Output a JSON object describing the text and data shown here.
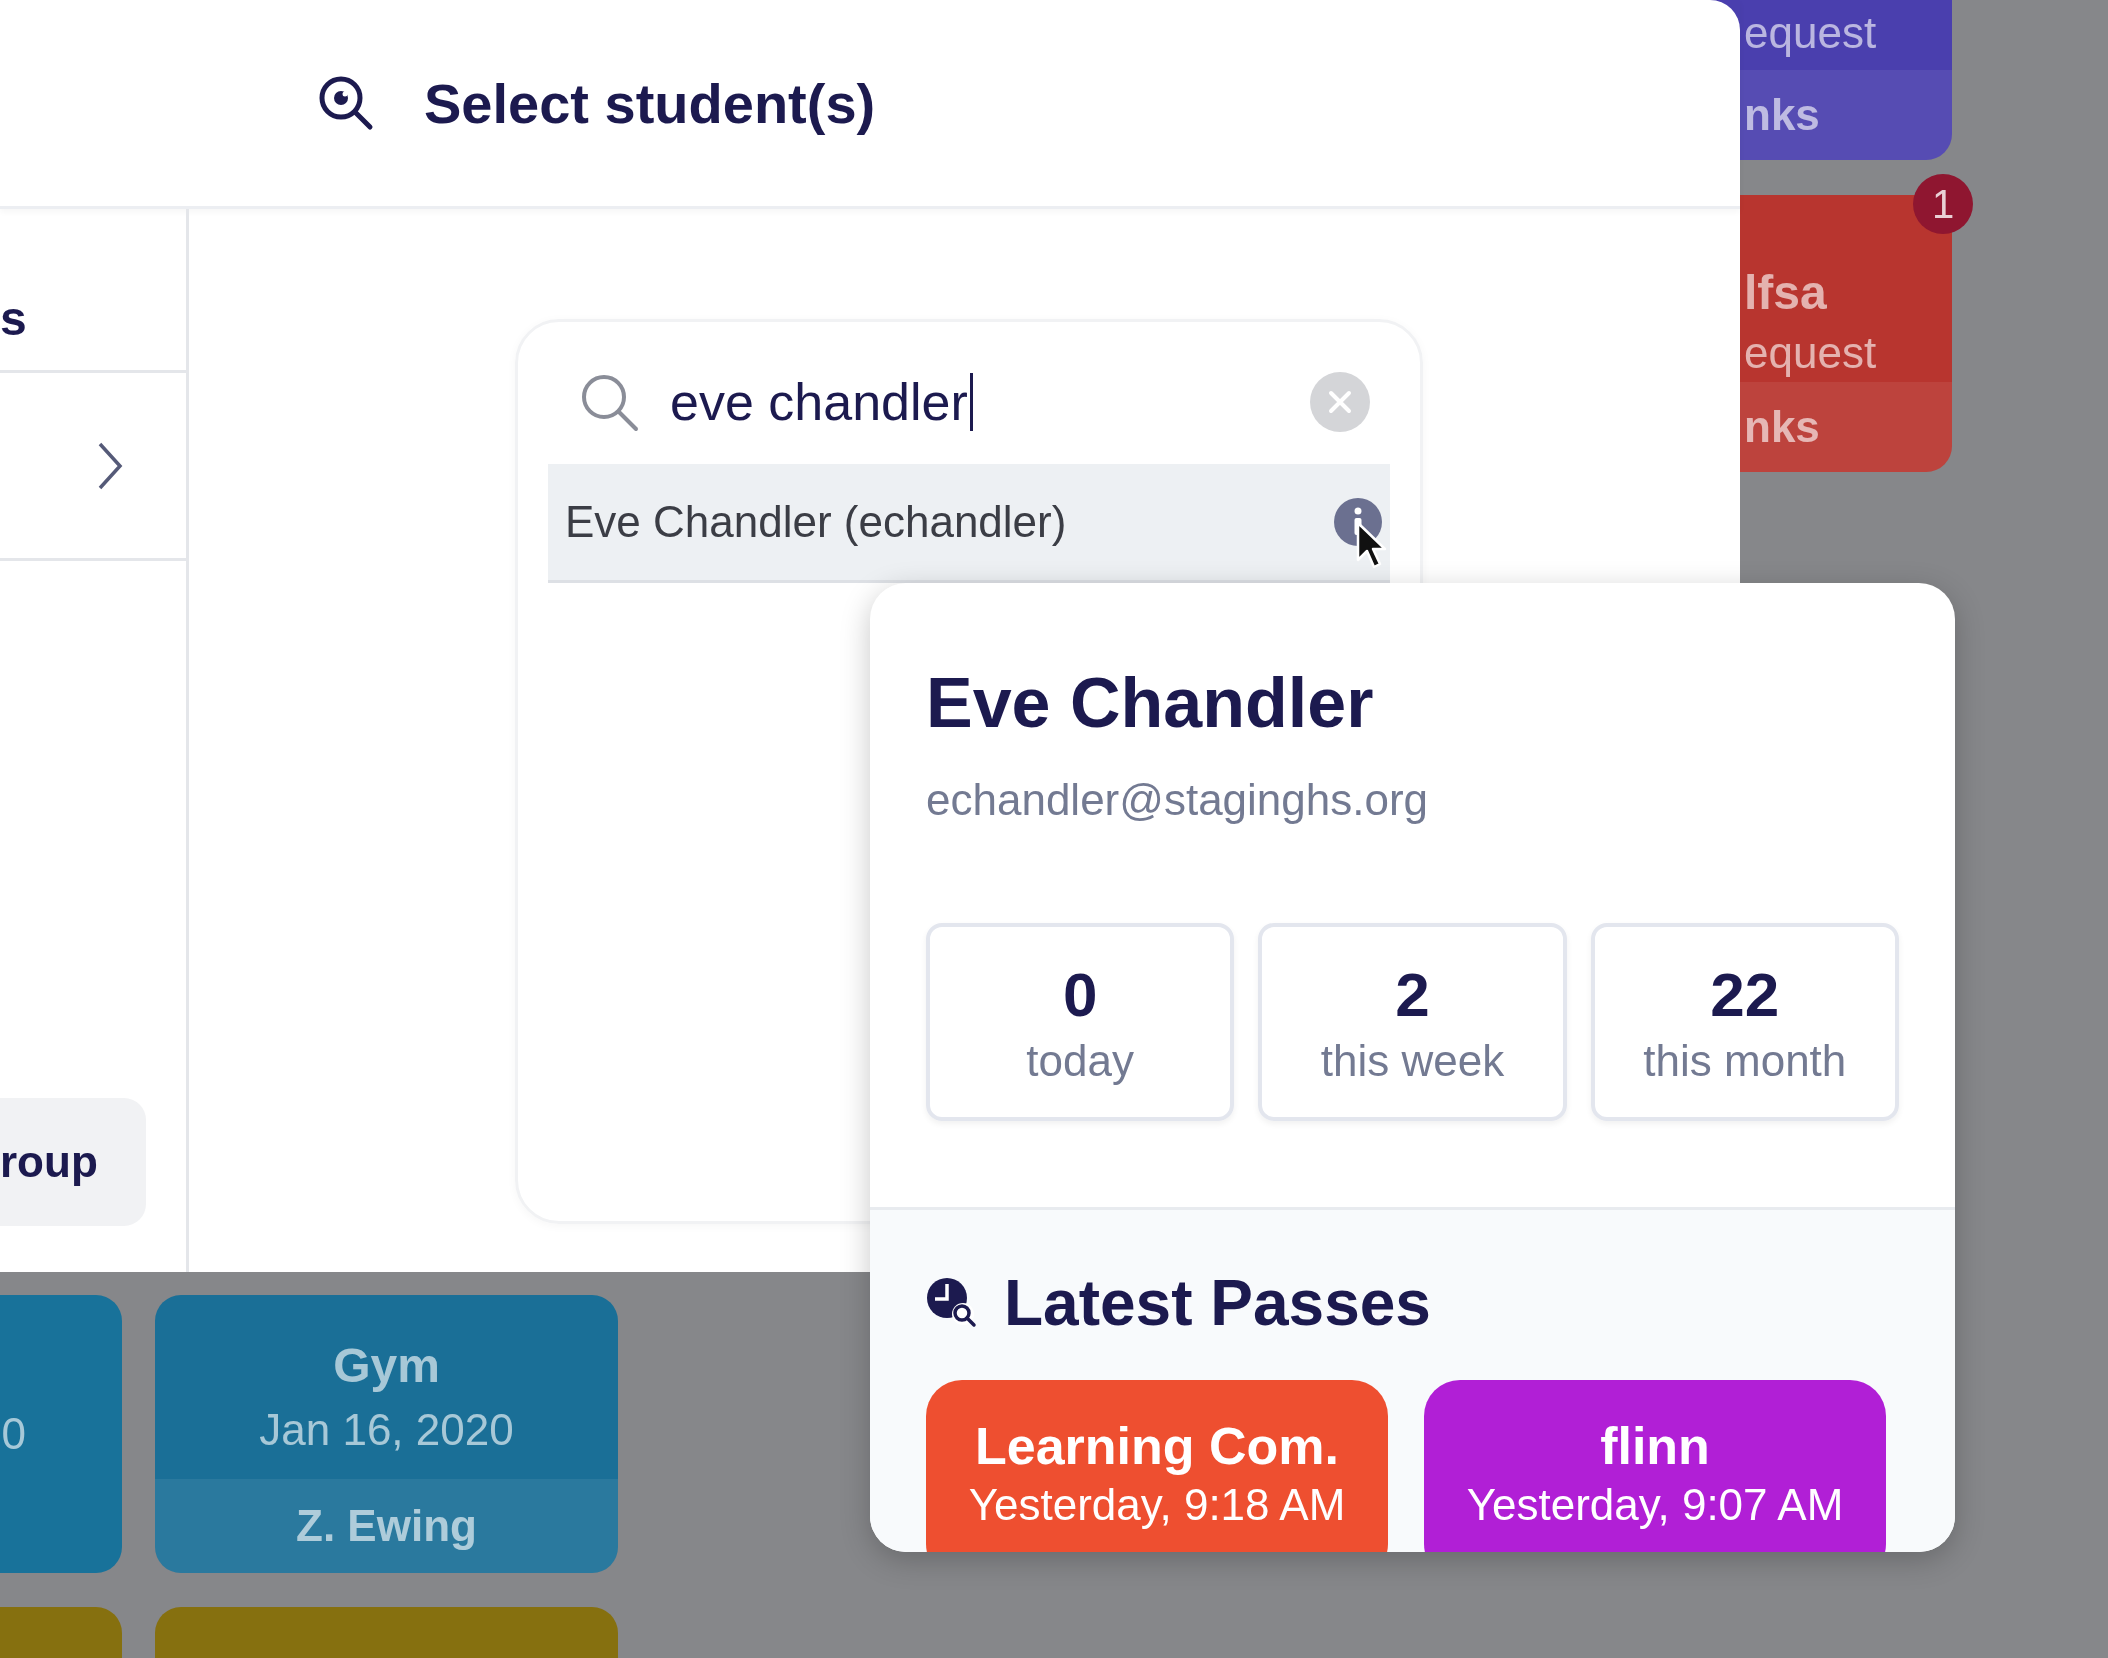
{
  "background_passes": [
    {
      "subtitle": "equest",
      "footer": "nks",
      "color": "#4a3fae"
    },
    {
      "title": "lfsa",
      "subtitle": "equest",
      "footer": "nks",
      "color": "#b8352f",
      "badge": "1"
    },
    {
      "subtitle": "0",
      "color": "#18729a"
    },
    {
      "title": "Gym",
      "subtitle": "Jan 16, 2020",
      "footer": "Z. Ewing",
      "color": "#1a6f97"
    },
    {
      "color": "#86700f"
    },
    {
      "color": "#86700f"
    }
  ],
  "modal": {
    "title": "Select student(s)",
    "sidebar": {
      "items": [
        {
          "kind": "heading",
          "label": "s"
        },
        {
          "kind": "chevron"
        },
        {
          "kind": "button",
          "label": "roup"
        }
      ]
    },
    "search": {
      "value": "eve chandler"
    },
    "results": [
      {
        "label": "Eve Chandler (echandler)",
        "selected": true
      }
    ]
  },
  "student_card": {
    "name": "Eve Chandler",
    "email": "echandler@staginghs.org",
    "stats": [
      {
        "value": "0",
        "label": "today"
      },
      {
        "value": "2",
        "label": "this week"
      },
      {
        "value": "22",
        "label": "this month"
      }
    ],
    "latest_passes": {
      "title": "Latest Passes",
      "passes": [
        {
          "destination": "Learning Com.",
          "time": "Yesterday, 9:18 AM",
          "color": "#ee4f30"
        },
        {
          "destination": "flinn",
          "time": "Yesterday, 9:07 AM",
          "color": "#b11fd6"
        }
      ]
    }
  }
}
